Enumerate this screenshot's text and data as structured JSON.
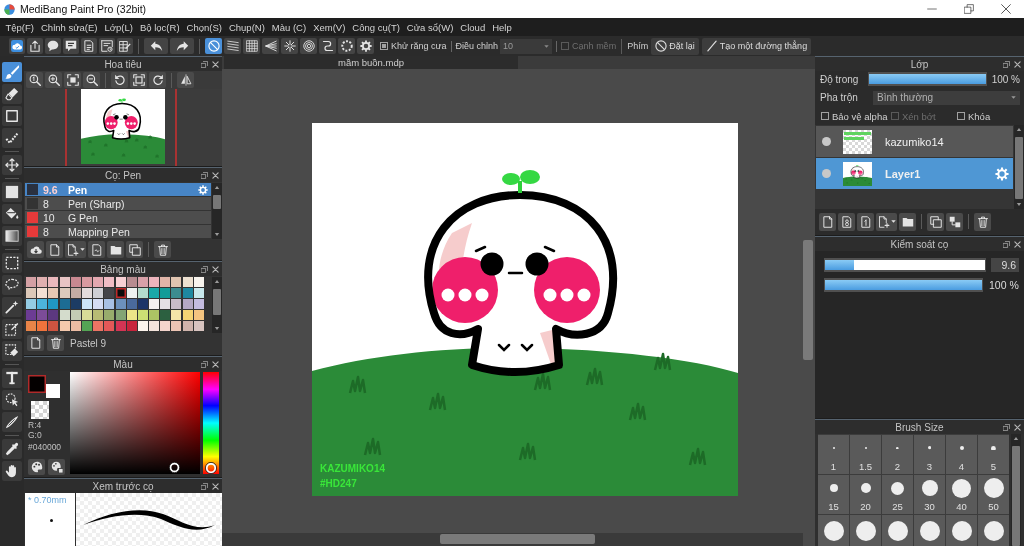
{
  "window": {
    "title": "MediBang Paint Pro (32bit)"
  },
  "menu": [
    "Tệp(F)",
    "Chỉnh sửa(E)",
    "Lớp(L)",
    "Bộ lọc(R)",
    "Chọn(S)",
    "Chụp(N)",
    "Màu (C)",
    "Xem(V)",
    "Công cụ(T)",
    "Cửa sổ(W)",
    "Cloud",
    "Help"
  ],
  "toolbar": {
    "snap_buttons": [
      {
        "selected": true
      },
      {
        "selected": false
      },
      {
        "selected": false
      },
      {
        "selected": false
      },
      {
        "selected": false
      },
      {
        "selected": false
      },
      {
        "selected": false
      },
      {
        "selected": false
      },
      {
        "selected": false
      }
    ],
    "antialias": {
      "label": "Khử răng cưa",
      "checked": true
    },
    "correction": {
      "label": "Điều chỉnh",
      "value": "10"
    },
    "soft_edge": {
      "label": "Cạnh mềm",
      "checked": false,
      "disabled": true
    },
    "keys_label": "Phím",
    "buttons": [
      "Đặt lại",
      "Tạo một đường thẳng"
    ]
  },
  "tools": [
    {
      "selected": true
    },
    {
      "selected": false
    },
    {
      "selected": false
    },
    {
      "selected": false
    },
    {
      "selected": false
    },
    {
      "selected": false
    },
    {
      "selected": false
    },
    {
      "selected": false
    },
    {
      "selected": false
    },
    {
      "selected": false
    },
    {
      "selected": false
    },
    {
      "selected": false
    },
    {
      "selected": false
    },
    {
      "selected": false
    },
    {
      "selected": false
    },
    {
      "selected": false
    },
    {
      "selected": false
    },
    {
      "selected": false
    }
  ],
  "navigator": {
    "title": "Hoa tiêu"
  },
  "brush_panel": {
    "title": "Cọ: Pen",
    "brushes": [
      {
        "size": "9.6",
        "name": "Pen",
        "color": "#2a3140",
        "selected": true
      },
      {
        "size": "8",
        "name": "Pen (Sharp)",
        "color": "#333333",
        "selected": false
      },
      {
        "size": "10",
        "name": "G Pen",
        "color": "#e63a3a",
        "selected": false
      },
      {
        "size": "8",
        "name": "Mapping Pen",
        "color": "#e63a3a",
        "selected": false
      }
    ]
  },
  "palette": {
    "title": "Bảng màu",
    "swatches": [
      {
        "color": "#d4a0a4",
        "selected": false
      },
      {
        "color": "#e0b0b0",
        "selected": false
      },
      {
        "color": "#eab8bc",
        "selected": false
      },
      {
        "color": "#e8c4c4",
        "selected": false
      },
      {
        "color": "#c88890",
        "selected": false
      },
      {
        "color": "#d89aa0",
        "selected": false
      },
      {
        "color": "#e4a8b0",
        "selected": false
      },
      {
        "color": "#f0bcc4",
        "selected": false
      },
      {
        "color": "#f8d0d4",
        "selected": false
      },
      {
        "color": "#b88c90",
        "selected": false
      },
      {
        "color": "#d8a0a8",
        "selected": false
      },
      {
        "color": "#ecb4bc",
        "selected": false
      },
      {
        "color": "#e0b4a8",
        "selected": false
      },
      {
        "color": "#e0c4b0",
        "selected": false
      },
      {
        "color": "#ece0d0",
        "selected": false
      },
      {
        "color": "#f8f4ee",
        "selected": false
      },
      {
        "color": "#dcc8b8",
        "selected": false
      },
      {
        "color": "#f4e0d4",
        "selected": false
      },
      {
        "color": "#e8c8b4",
        "selected": false
      },
      {
        "color": "#dccabc",
        "selected": false
      },
      {
        "color": "#c4aca4",
        "selected": false
      },
      {
        "color": "#e4dcdc",
        "selected": false
      },
      {
        "color": "#cfcfd4",
        "selected": false
      },
      {
        "color": "#444448",
        "selected": false
      },
      {
        "color": "#0c0c0c",
        "selected": true
      },
      {
        "color": "#eef2f0",
        "selected": false
      },
      {
        "color": "#b4dccc",
        "selected": false
      },
      {
        "color": "#1aa8a8",
        "selected": false
      },
      {
        "color": "#129c98",
        "selected": false
      },
      {
        "color": "#3c8c90",
        "selected": false
      },
      {
        "color": "#1e88a0",
        "selected": false
      },
      {
        "color": "#c8e8ec",
        "selected": false
      },
      {
        "color": "#94cce4",
        "selected": false
      },
      {
        "color": "#4cb4dc",
        "selected": false
      },
      {
        "color": "#2098c4",
        "selected": false
      },
      {
        "color": "#1c6c94",
        "selected": false
      },
      {
        "color": "#1c3c64",
        "selected": false
      },
      {
        "color": "#cce4f8",
        "selected": false
      },
      {
        "color": "#d4dcf4",
        "selected": false
      },
      {
        "color": "#a8c0e4",
        "selected": false
      },
      {
        "color": "#6c90bc",
        "selected": false
      },
      {
        "color": "#4a6a9c",
        "selected": false
      },
      {
        "color": "#1c3468",
        "selected": false
      },
      {
        "color": "#f4f0f0",
        "selected": false
      },
      {
        "color": "#e4e0e4",
        "selected": false
      },
      {
        "color": "#c8bcc8",
        "selected": false
      },
      {
        "color": "#b4a8c4",
        "selected": false
      },
      {
        "color": "#c4bce0",
        "selected": false
      },
      {
        "color": "#6c3c94",
        "selected": false
      },
      {
        "color": "#7c4c98",
        "selected": false
      },
      {
        "color": "#5c3880",
        "selected": false
      },
      {
        "color": "#d4dccc",
        "selected": false
      },
      {
        "color": "#c4ccb4",
        "selected": false
      },
      {
        "color": "#d8dc98",
        "selected": false
      },
      {
        "color": "#b8bc74",
        "selected": false
      },
      {
        "color": "#98ac6c",
        "selected": false
      },
      {
        "color": "#84a474",
        "selected": false
      },
      {
        "color": "#ece488",
        "selected": false
      },
      {
        "color": "#cce074",
        "selected": false
      },
      {
        "color": "#acc464",
        "selected": false
      },
      {
        "color": "#2c6040",
        "selected": false
      },
      {
        "color": "#f4e4a8",
        "selected": false
      },
      {
        "color": "#f4d474",
        "selected": false
      },
      {
        "color": "#f4c480",
        "selected": false
      },
      {
        "color": "#e88448",
        "selected": false
      },
      {
        "color": "#f0743c",
        "selected": false
      },
      {
        "color": "#cc5440",
        "selected": false
      },
      {
        "color": "#f4c8ac",
        "selected": false
      },
      {
        "color": "#ecbca4",
        "selected": false
      },
      {
        "color": "#54a454",
        "selected": false
      },
      {
        "color": "#ec7464",
        "selected": false
      },
      {
        "color": "#e45858",
        "selected": false
      },
      {
        "color": "#d43454",
        "selected": false
      },
      {
        "color": "#c8243c",
        "selected": false
      },
      {
        "color": "#fcf4ec",
        "selected": false
      },
      {
        "color": "#f4e4dc",
        "selected": false
      },
      {
        "color": "#f4d4cc",
        "selected": false
      },
      {
        "color": "#ecc4b4",
        "selected": false
      },
      {
        "color": "#d0b4ac",
        "selected": false
      },
      {
        "color": "#d8c4c0",
        "selected": false
      }
    ],
    "name": "Pastel 9"
  },
  "color_panel": {
    "title": "Màu",
    "current_colors": [
      {
        "color": "#040000",
        "selected": true
      },
      {
        "color": "#ffffff",
        "selected": false
      }
    ],
    "readouts": [
      "R:4",
      "G:0"
    ],
    "hex": "#040000",
    "hue": {
      "level": 0
    }
  },
  "brush_preview": {
    "title": "Xem trước cọ",
    "size_label": "* 0.70mm"
  },
  "document": {
    "tab": "mầm buồn.mdp",
    "signature": [
      "KAZUMIKO14",
      "#HD247"
    ]
  },
  "layer_panel": {
    "title": "Lớp",
    "opacity": {
      "label": "Độ trong",
      "level": 1,
      "reading": "100 %"
    },
    "blend": {
      "label": "Pha trộn",
      "value": "Bình thường"
    },
    "options": [
      {
        "label": "Bảo vệ alpha",
        "checked": false,
        "disabled": false
      },
      {
        "label": "Xén bớt",
        "checked": false,
        "disabled": true
      },
      {
        "label": "Khóa",
        "checked": false,
        "disabled": false
      }
    ],
    "layers": [
      {
        "name": "kazumiko14",
        "selected": false
      },
      {
        "name": "Layer1",
        "selected": true
      }
    ]
  },
  "brush_control": {
    "title": "Kiểm soát cọ",
    "size": {
      "level": 0.18,
      "value": "9.6"
    },
    "opacity": {
      "level": 1,
      "reading": "100 %"
    }
  },
  "brush_size": {
    "title": "Brush Size",
    "items": [
      {
        "kind": "labeled",
        "label": "1"
      },
      {
        "kind": "labeled",
        "label": "1.5"
      },
      {
        "kind": "labeled",
        "label": "2"
      },
      {
        "kind": "labeled",
        "label": "3"
      },
      {
        "kind": "labeled",
        "label": "4"
      },
      {
        "kind": "labeled",
        "label": "5"
      },
      {
        "kind": "labeled",
        "label": "15"
      },
      {
        "kind": "labeled",
        "label": "20"
      },
      {
        "kind": "labeled",
        "label": "25"
      },
      {
        "kind": "labeled",
        "label": "30"
      },
      {
        "kind": "labeled",
        "label": "40"
      },
      {
        "kind": "labeled",
        "label": "50"
      },
      {
        "kind": "unlabeled"
      },
      {
        "kind": "unlabeled"
      },
      {
        "kind": "unlabeled"
      },
      {
        "kind": "unlabeled"
      },
      {
        "kind": "unlabeled"
      },
      {
        "kind": "unlabeled"
      }
    ]
  }
}
